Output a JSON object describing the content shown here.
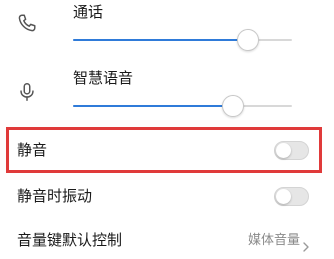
{
  "volume": {
    "call": {
      "label": "通话",
      "icon": "phone-icon",
      "level": 0.8
    },
    "voice_assistant": {
      "label": "智慧语音",
      "icon": "microphone-icon",
      "level": 0.73
    }
  },
  "settings": {
    "mute": {
      "label": "静音",
      "on": false
    },
    "vibrate_on_mute": {
      "label": "静音时振动",
      "on": false
    },
    "key_control": {
      "label": "音量键默认控制",
      "value": "媒体音量"
    }
  },
  "colors": {
    "accent": "#2f7bd9",
    "highlight": "#e03a3a",
    "secondary_text": "#8a8a8a"
  }
}
